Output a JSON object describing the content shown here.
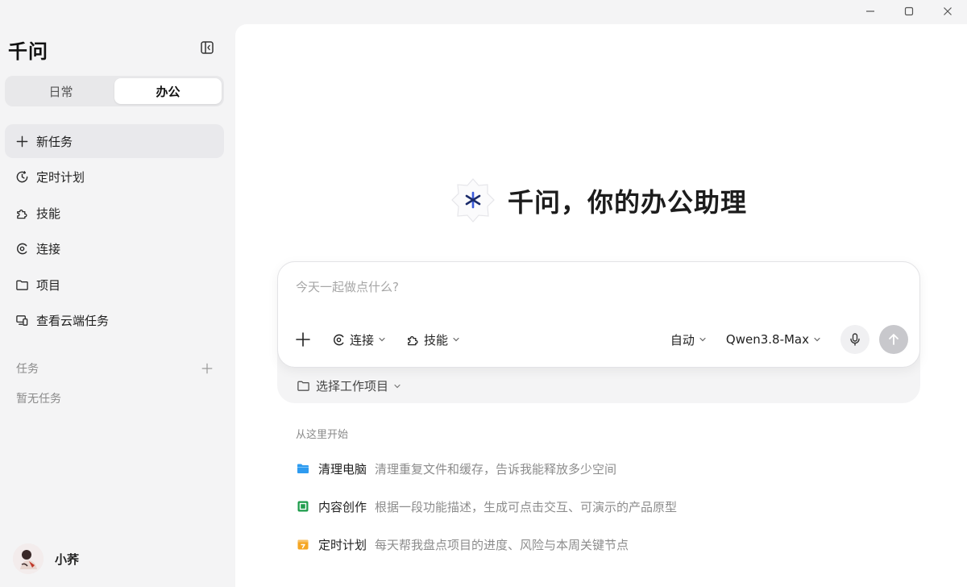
{
  "window": {
    "minimize_icon": "minimize-icon",
    "maximize_icon": "maximize-icon",
    "close_icon": "close-icon"
  },
  "sidebar": {
    "brand": "千问",
    "collapse_icon": "sidebar-collapse-icon",
    "modes": [
      {
        "label": "日常",
        "active": false
      },
      {
        "label": "办公",
        "active": true
      }
    ],
    "nav": [
      {
        "label": "新任务",
        "icon": "plus-icon",
        "selected": true
      },
      {
        "label": "定时计划",
        "icon": "clock-icon",
        "selected": false
      },
      {
        "label": "技能",
        "icon": "puzzle-icon",
        "selected": false
      },
      {
        "label": "连接",
        "icon": "connect-icon",
        "selected": false
      },
      {
        "label": "项目",
        "icon": "folder-icon",
        "selected": false
      },
      {
        "label": "查看云端任务",
        "icon": "cloud-devices-icon",
        "selected": false
      }
    ],
    "tasks_header": "任务",
    "tasks_empty": "暂无任务",
    "user": {
      "name": "小荞",
      "avatar_icon": "avatar-image"
    }
  },
  "main": {
    "hero_title": "千问，你的办公助理",
    "composer": {
      "placeholder": "今天一起做点什么?",
      "connect_label": "连接",
      "skills_label": "技能",
      "mode_label": "自动",
      "model_label": "Qwen3.8-Max"
    },
    "project_picker": "选择工作项目",
    "start_label": "从这里开始",
    "suggestions": [
      {
        "title": "清理电脑",
        "desc": "清理重复文件和缓存，告诉我能释放多少空间",
        "icon": "folder-blue-icon",
        "color": "#2e9bf0"
      },
      {
        "title": "内容创作",
        "desc": "根据一段功能描述，生成可点击交互、可演示的产品原型",
        "icon": "doc-green-icon",
        "color": "#1f9d4c"
      },
      {
        "title": "定时计划",
        "desc": "每天帮我盘点项目的进度、风险与本周关键节点",
        "icon": "calendar-orange-icon",
        "color": "#f5a623"
      }
    ]
  }
}
